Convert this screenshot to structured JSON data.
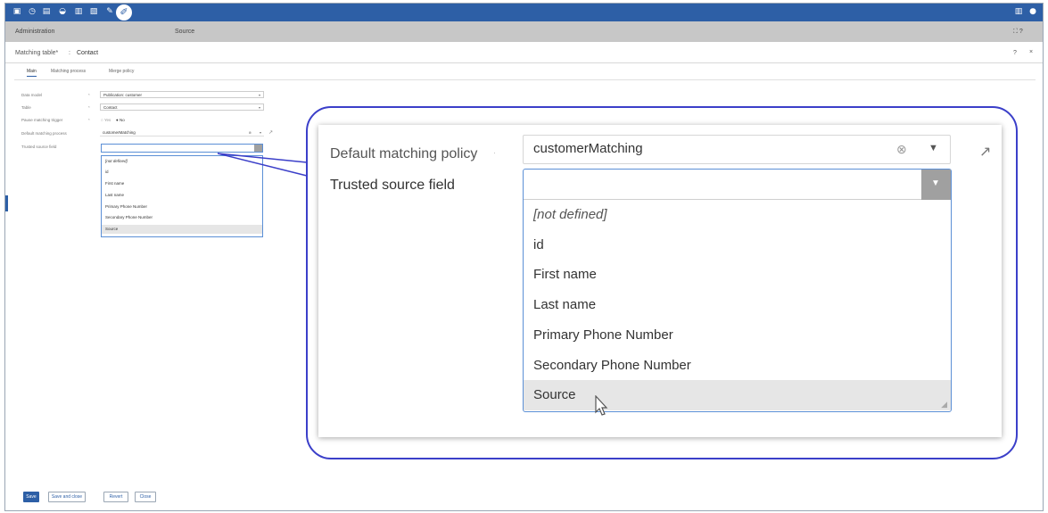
{
  "toolbar": {
    "icons": [
      "database-icon",
      "clock-icon",
      "document-icon",
      "layers-icon",
      "bookmark-icon",
      "flag-icon",
      "pin-icon",
      "wrench-icon"
    ],
    "right_icons": [
      "grid-icon",
      "user-icon"
    ]
  },
  "adminbar": {
    "left": "Administration",
    "center": "Source",
    "right_icons": "⛶  ?"
  },
  "titlerow": {
    "table_label": "Matching table*",
    "separator": ":",
    "table_value": "Contact",
    "help": "?",
    "close": "×"
  },
  "tabs": [
    "Main",
    "Matching process",
    "Merge policy"
  ],
  "form": {
    "fields": [
      {
        "label": "Data model",
        "req": "*",
        "value": "Publication: customer"
      },
      {
        "label": "Table",
        "req": "*",
        "value": "Contact"
      },
      {
        "label": "Pause matching trigger",
        "req": "*",
        "radio_yes": "Yes",
        "radio_no": "No"
      },
      {
        "label": "Default matching process",
        "value": "customerMatching"
      },
      {
        "label": "Trusted source field",
        "value": ""
      }
    ]
  },
  "options": [
    "[not defined]",
    "id",
    "First name",
    "Last name",
    "Primary Phone Number",
    "Secondary Phone Number",
    "Source"
  ],
  "zoom": {
    "default_label": "Default matching policy",
    "default_value": "customerMatching",
    "trusted_label": "Trusted source field"
  },
  "buttons": {
    "save": "Save",
    "save_close": "Save and close",
    "revert": "Revert",
    "close": "Close"
  },
  "colors": {
    "brand": "#2d5fa6",
    "callout": "#3b3fc9",
    "highlight": "#e6e6e6"
  }
}
